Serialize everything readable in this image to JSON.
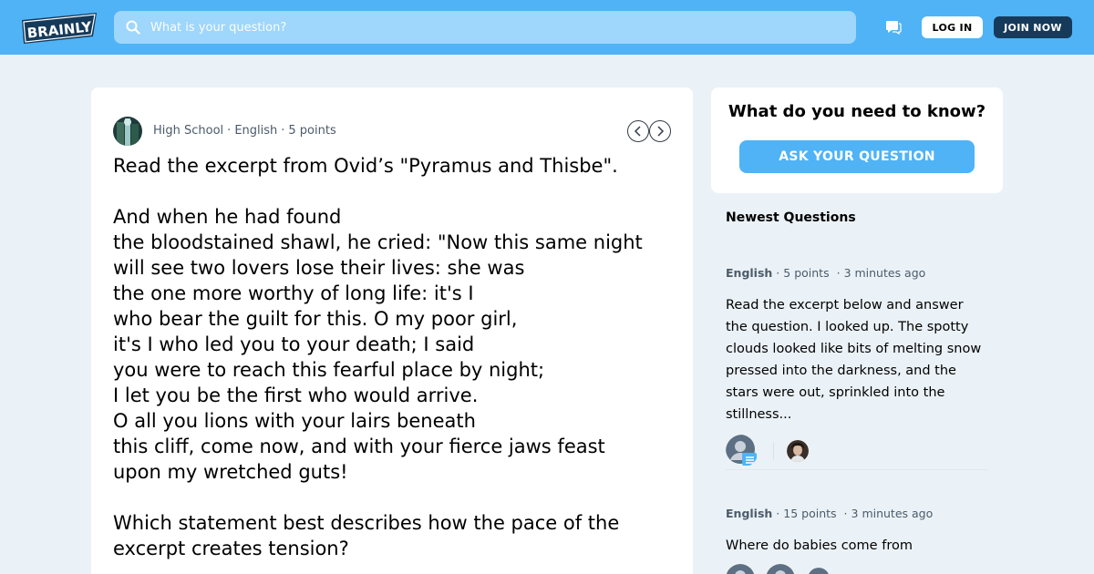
{
  "header": {
    "logo_text": "BRAINLY",
    "search_placeholder": "What is your question?",
    "login_label": "LOG IN",
    "join_label": "JOIN NOW"
  },
  "question": {
    "level": "High School",
    "subject": "English",
    "points": "5 points",
    "text": "Read the excerpt from Ovid’s \"Pyramus and Thisbe\".\n\nAnd when he had found\nthe bloodstained shawl, he cried: \"Now this same night\nwill see two lovers lose their lives: she was\nthe one more worthy of long life: it's I\nwho bear the guilt for this. O my poor girl,\nit's I who led you to your death; I said\nyou were to reach this fearful place by night;\nI let you be the first who would arrive.\nO all you lions with your lairs beneath\nthis cliff, come now, and with your fierce jaws feast\nupon my wretched guts!\n\nWhich statement best describes how the pace of the\nexcerpt creates tension?"
  },
  "ask": {
    "title": "What do you need to know?",
    "button": "ASK YOUR QUESTION"
  },
  "newest": {
    "title": "Newest Questions",
    "items": [
      {
        "subject": "English",
        "points": "5 points",
        "time": "3 minutes ago",
        "text": "Read the excerpt below and answer the question. I looked up. The spotty clouds looked like bits of melting snow pressed into the darkness, and the stars were out, sprinkled into the stillness..."
      },
      {
        "subject": "English",
        "points": "15 points",
        "time": "3 minutes ago",
        "text": "Where do babies come from"
      }
    ]
  },
  "colors": {
    "brand_blue": "#4fb3f6",
    "dark_navy": "#163a5a",
    "page_bg": "#ebf2f7"
  }
}
